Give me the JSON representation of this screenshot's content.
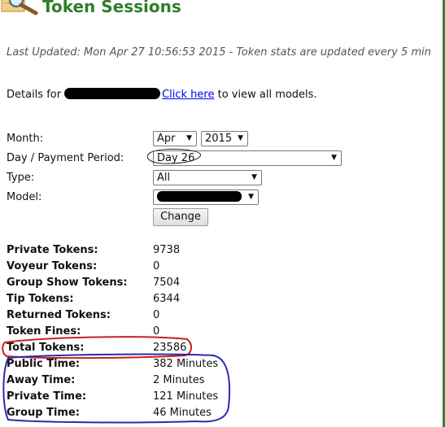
{
  "header": {
    "title": "Token Sessions",
    "icon": "magnifier-icon"
  },
  "last_updated": "Last Updated: Mon Apr 27 10:56:53 2015 - Token stats are updated every 5 min",
  "details": {
    "prefix": "Details for",
    "link_text": "Click here",
    "suffix": " to view all models."
  },
  "form": {
    "month_label": "Month:",
    "month_value": "Apr",
    "year_value": "2015",
    "day_label": "Day / Payment Period:",
    "day_value": "Day 26",
    "type_label": "Type:",
    "type_value": "All",
    "model_label": "Model:",
    "change_button": "Change"
  },
  "stats": [
    {
      "label": "Private Tokens:",
      "value": "9738"
    },
    {
      "label": "Voyeur Tokens:",
      "value": "0"
    },
    {
      "label": "Group Show Tokens:",
      "value": "7504"
    },
    {
      "label": "Tip Tokens:",
      "value": "6344"
    },
    {
      "label": "Returned Tokens:",
      "value": "0"
    },
    {
      "label": "Token Fines:",
      "value": "0"
    },
    {
      "label": "Total Tokens:",
      "value": "23586"
    },
    {
      "label": "Public Time:",
      "value": "382 Minutes"
    },
    {
      "label": "Away Time:",
      "value": "2 Minutes"
    },
    {
      "label": "Private Time:",
      "value": "121 Minutes"
    },
    {
      "label": "Group Time:",
      "value": "46 Minutes"
    }
  ],
  "colors": {
    "title": "#2f7d2a",
    "link": "#0000ee",
    "red_annotation": "#cc1f1f",
    "blue_annotation": "#2b2bb0"
  }
}
